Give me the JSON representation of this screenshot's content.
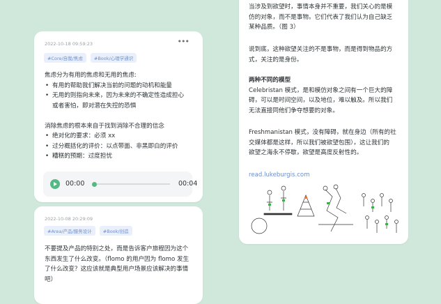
{
  "memo1": {
    "timestamp": "2022-10-18 09:59:23",
    "more": "•••",
    "tags": [
      "#Core/自我/焦虑",
      "#Book/心理学通识"
    ],
    "lines": [
      {
        "text": "焦虑分为有用的焦虑和无用的焦虑:",
        "bullet": false
      },
      {
        "text": "有用的帮助我们解决当前的问题的动机和能量",
        "bullet": true
      },
      {
        "text": "无用的则指向未来，因为未来的不确定性造成担心",
        "bullet": true
      },
      {
        "text": "或者害怕，即对潜在失控的恐惧",
        "bullet": false,
        "indent": true
      },
      {
        "text": "",
        "bullet": false
      },
      {
        "text": "消除焦虑的根本来自于找到消除不合理的信念",
        "bullet": false
      },
      {
        "text": "绝对化的要求：必须 xx",
        "bullet": true
      },
      {
        "text": "过分概括化的评价：以点带面、非黑即白的评价",
        "bullet": true
      },
      {
        "text": "糟糕的预期：过度担忧",
        "bullet": true
      }
    ],
    "audio": {
      "start": "00:00",
      "end": "00:04",
      "progress": 0.0
    }
  },
  "memo2": {
    "timestamp": "2022-10-08 20:29:09",
    "more": "•••",
    "tags": [
      "#Area/产品/服务设计",
      "#Book/创造"
    ],
    "lines": [
      "不要提及产品的特别之处，而是告诉客户旅程因为这个",
      "东西发生了什么改变。（flomo 的用户因为 flomo 发生",
      "了什么改变？这应该就是典型用户场景应该解决的事情",
      "吧）"
    ]
  },
  "memo3": {
    "lines_top": [
      "当涉及到欲望时，事情本身并不重要，我们关心的是模",
      "仿的对象，而不是事物。它们代表了我们认为自己缺乏",
      "某种品质。（图 3）"
    ],
    "lines_mid": [
      "说到底，这种欲望关注的不是事物，而是得到物品的方",
      "式，关注的是身份。"
    ],
    "heading": "两种不同的模型",
    "lines_celeb": [
      "Celebristan 模式，是和模仿对象之间有一个巨大的障",
      "碍，可以是时间空间，以及地位，难以触及。所以我们",
      "无法直接同他们争夺想要的对象。"
    ],
    "lines_fresh": [
      "Freshmanistan 模式，没有障碍，就在身边（所有的社",
      "交媒体都是这样，所以我们被欲望包围），这让我们的",
      "欲望之海永不停歇，欲望是高度反射性的。"
    ],
    "link": "read.lukeburgis.com"
  }
}
